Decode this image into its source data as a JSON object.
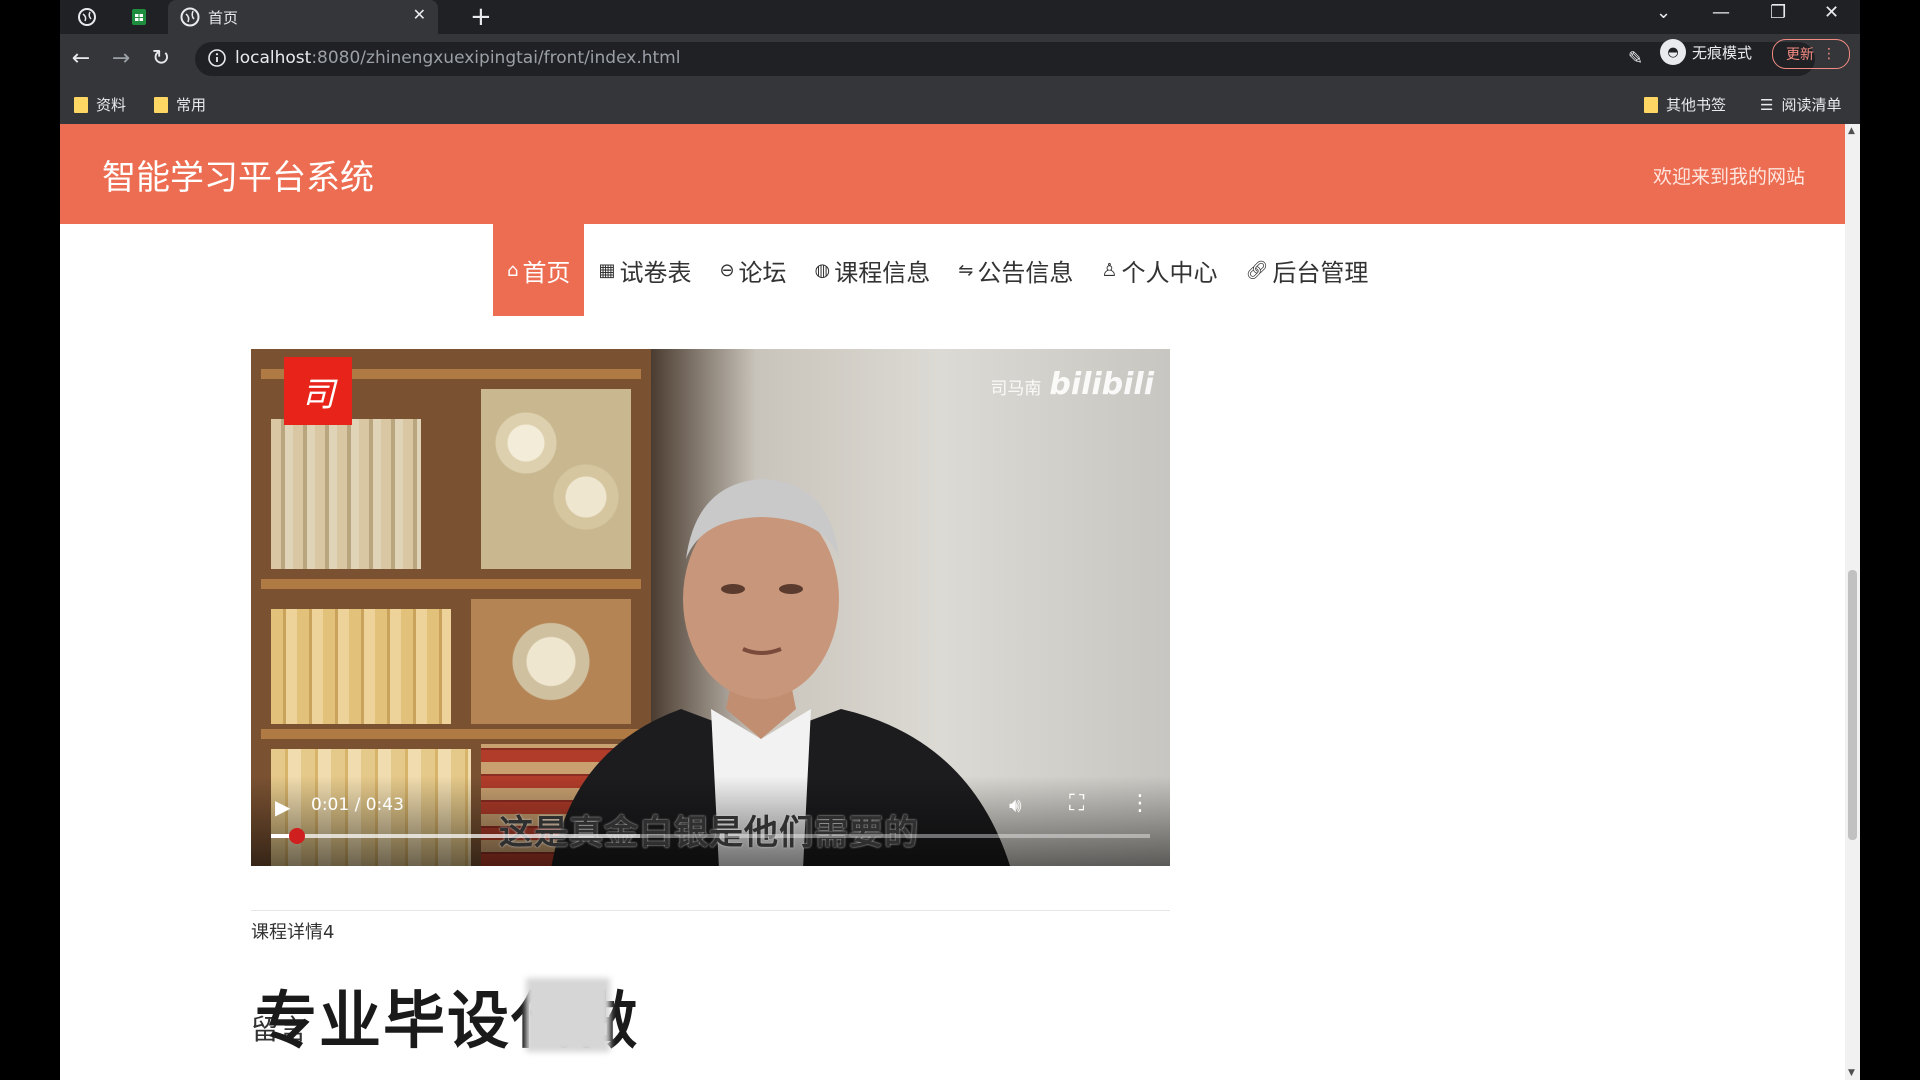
{
  "browser": {
    "tab_title": "首页",
    "url_host": "localhost",
    "url_path": ":8080/zhinengxuexipingtai/front/index.html",
    "incognito_label": "无痕模式",
    "update_label": "更新",
    "bookmarks": [
      {
        "label": "资料"
      },
      {
        "label": "常用"
      }
    ],
    "other_bookmarks_label": "其他书签",
    "reading_list_label": "阅读清单"
  },
  "site": {
    "title": "智能学习平台系统",
    "welcome": "欢迎来到我的网站",
    "accent_color": "#ed6d52",
    "menu": [
      {
        "label": "首页",
        "icon": "home-icon",
        "active": true
      },
      {
        "label": "试卷表",
        "icon": "grid-icon",
        "active": false
      },
      {
        "label": "论坛",
        "icon": "forum-icon",
        "active": false
      },
      {
        "label": "课程信息",
        "icon": "globe-icon",
        "active": false
      },
      {
        "label": "公告信息",
        "icon": "sliders-icon",
        "active": false
      },
      {
        "label": "个人中心",
        "icon": "user-icon",
        "active": false
      },
      {
        "label": "后台管理",
        "icon": "link-icon",
        "active": false
      }
    ]
  },
  "video": {
    "watermark_channel": "司马南",
    "watermark_brand": "bilibili",
    "logo_char": "司",
    "subtitle": "这是真金白银是他们需要的",
    "time": "0:01 / 0:43",
    "progress": 0.03,
    "buffered": 0.42
  },
  "content": {
    "course_detail": "课程详情4",
    "overlay_title": "专业毕设代做",
    "comment_label": "留言"
  }
}
